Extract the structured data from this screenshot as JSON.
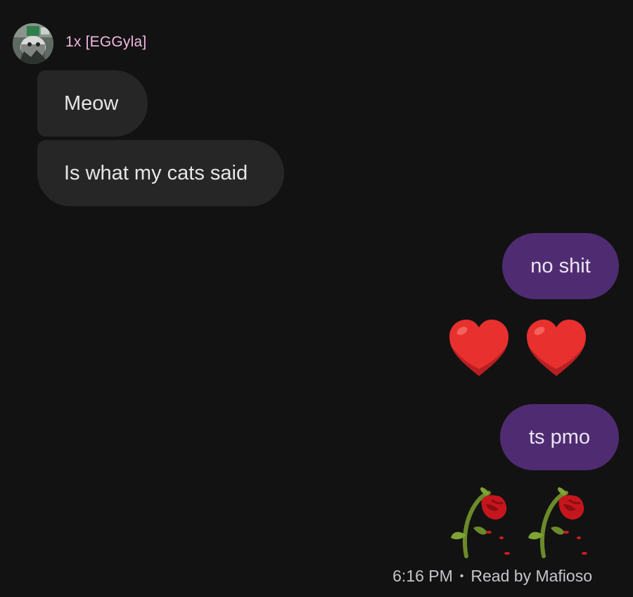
{
  "conversation": {
    "sender": {
      "name": "1x [EGGyla]",
      "name_color": "#f2b8e0",
      "avatar_icon": "contact-avatar-photo"
    },
    "incoming_messages": [
      {
        "text": "Meow"
      },
      {
        "text": "Is what my cats said"
      }
    ],
    "outgoing_messages": [
      {
        "text": "no shit"
      },
      {
        "emoji": [
          "red-heart",
          "red-heart"
        ]
      },
      {
        "text": "ts pmo"
      },
      {
        "emoji": [
          "wilted-rose",
          "wilted-rose"
        ]
      }
    ],
    "status": {
      "time": "6:16 PM",
      "separator": "•",
      "read_receipt": "Read by Mafioso"
    }
  },
  "colors": {
    "background": "#121212",
    "incoming_bubble": "#262626",
    "outgoing_bubble": "#4f2c72"
  }
}
